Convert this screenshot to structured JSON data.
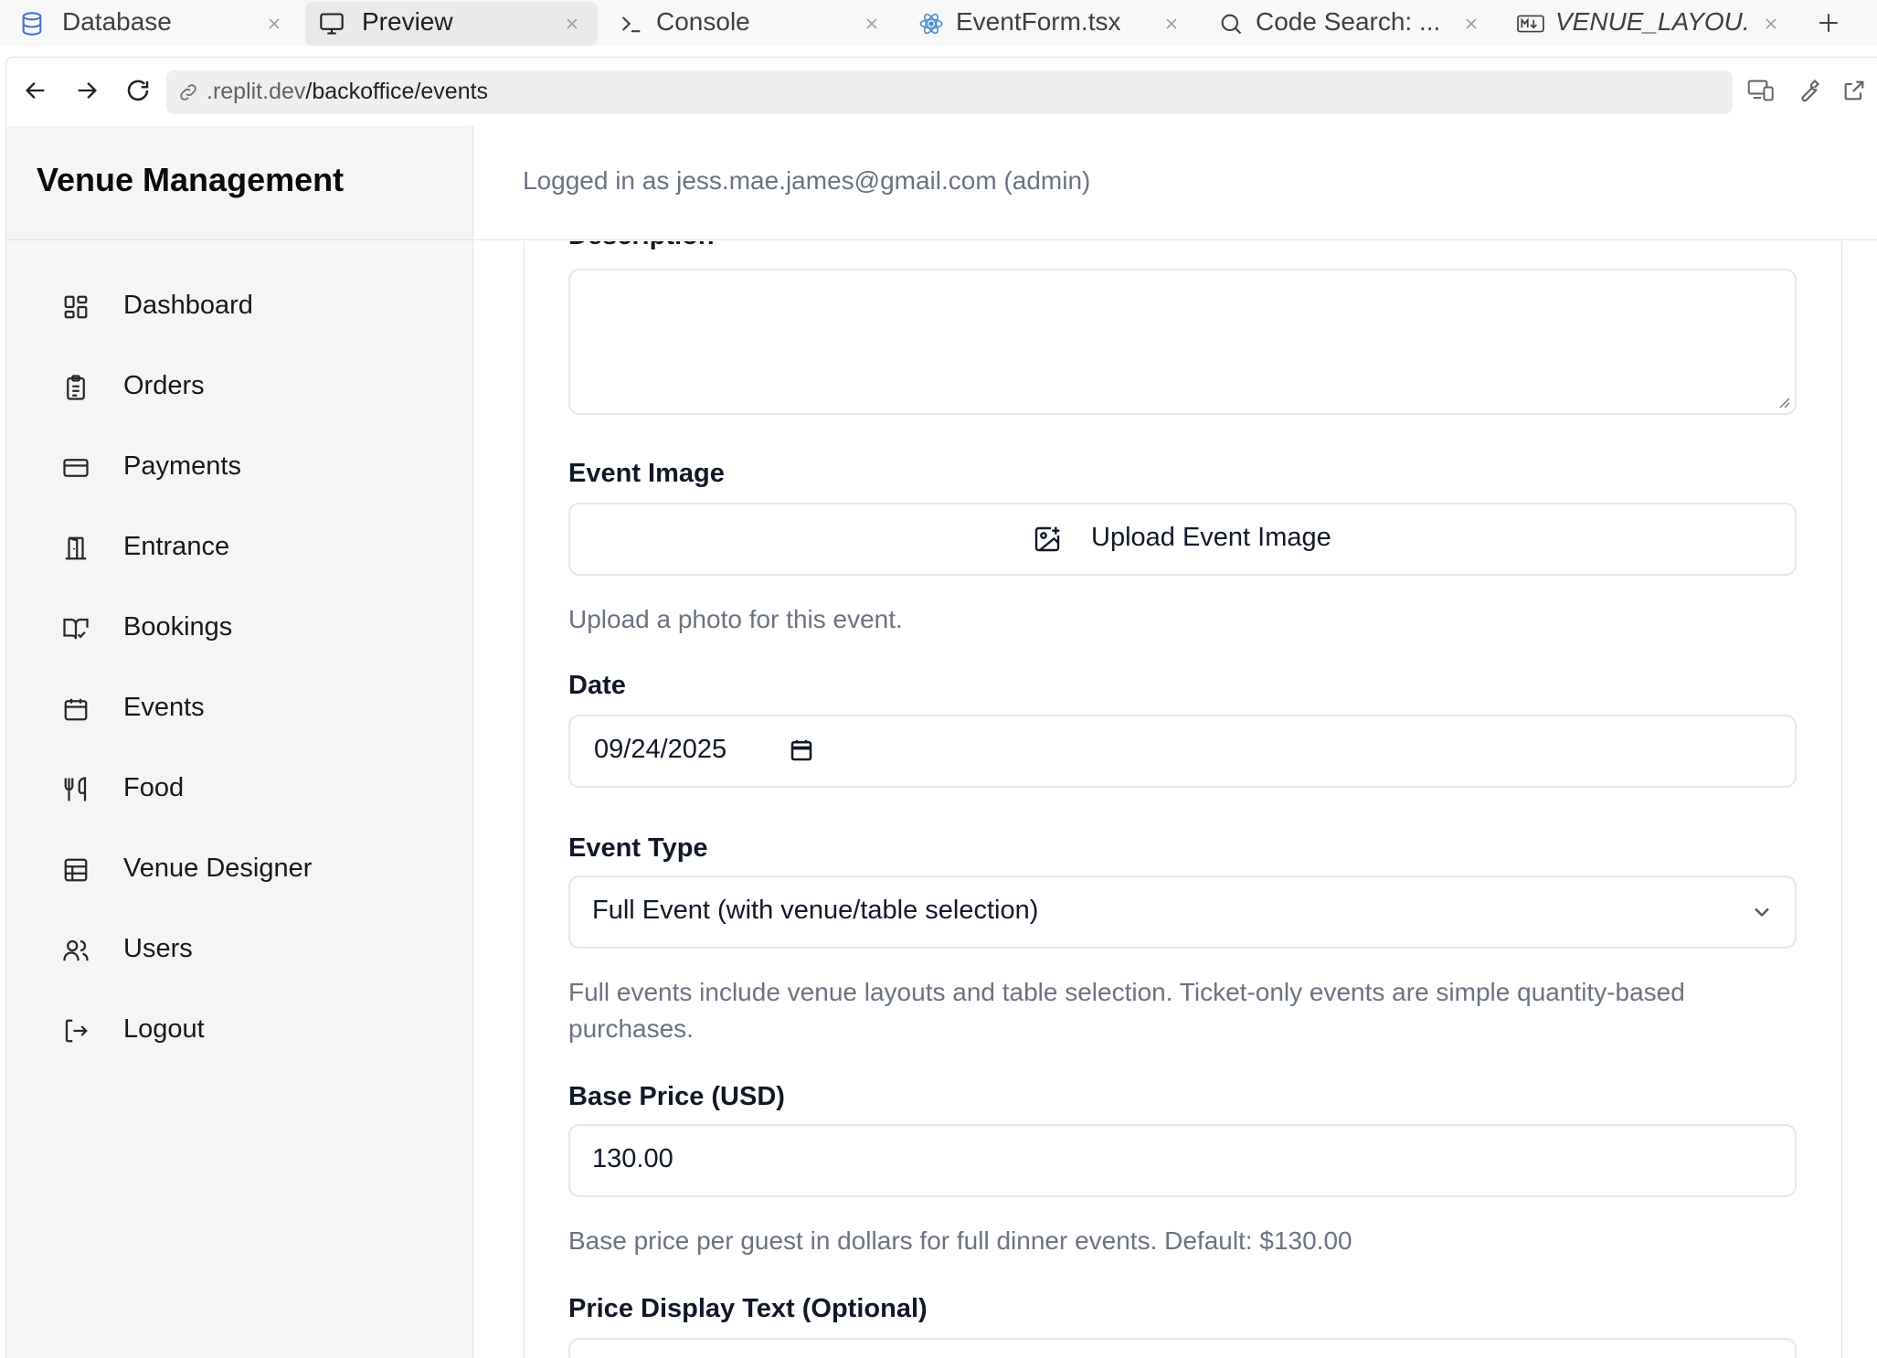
{
  "tabs": [
    {
      "label": "Database",
      "icon": "database-icon",
      "active": false
    },
    {
      "label": "Preview",
      "icon": "monitor-icon",
      "active": true
    },
    {
      "label": "Console",
      "icon": "terminal-icon",
      "active": false
    },
    {
      "label": "EventForm.tsx",
      "icon": "react-icon",
      "active": false
    },
    {
      "label": "Code Search: ...",
      "icon": "search-icon",
      "active": false
    },
    {
      "label": "VENUE_LAYOU...",
      "icon": "markdown-icon",
      "active": false
    }
  ],
  "browser": {
    "url_host": ".replit.dev",
    "url_path": "/backoffice/events"
  },
  "sidebar": {
    "brand": "Venue Management",
    "items": [
      {
        "label": "Dashboard",
        "icon": "dashboard-icon"
      },
      {
        "label": "Orders",
        "icon": "clipboard-icon"
      },
      {
        "label": "Payments",
        "icon": "credit-card-icon"
      },
      {
        "label": "Entrance",
        "icon": "door-icon"
      },
      {
        "label": "Bookings",
        "icon": "book-check-icon"
      },
      {
        "label": "Events",
        "icon": "calendar-icon"
      },
      {
        "label": "Food",
        "icon": "utensils-icon"
      },
      {
        "label": "Venue Designer",
        "icon": "grid-icon"
      },
      {
        "label": "Users",
        "icon": "users-icon"
      },
      {
        "label": "Logout",
        "icon": "logout-icon"
      }
    ]
  },
  "header": {
    "logged_in_text": "Logged in as jess.mae.james@gmail.com (admin)"
  },
  "form": {
    "description_label": "Description",
    "description_value": "",
    "image_label": "Event Image",
    "upload_button": "Upload Event Image",
    "image_help": "Upload a photo for this event.",
    "date_label": "Date",
    "date_value": "09/24/2025",
    "event_type_label": "Event Type",
    "event_type_value": "Full Event (with venue/table selection)",
    "event_type_help": "Full events include venue layouts and table selection. Ticket-only events are simple quantity-based purchases.",
    "base_price_label": "Base Price (USD)",
    "base_price_value": "130.00",
    "base_price_help": "Base price per guest in dollars for full dinner events. Default: $130.00",
    "price_display_label": "Price Display Text (Optional)"
  }
}
